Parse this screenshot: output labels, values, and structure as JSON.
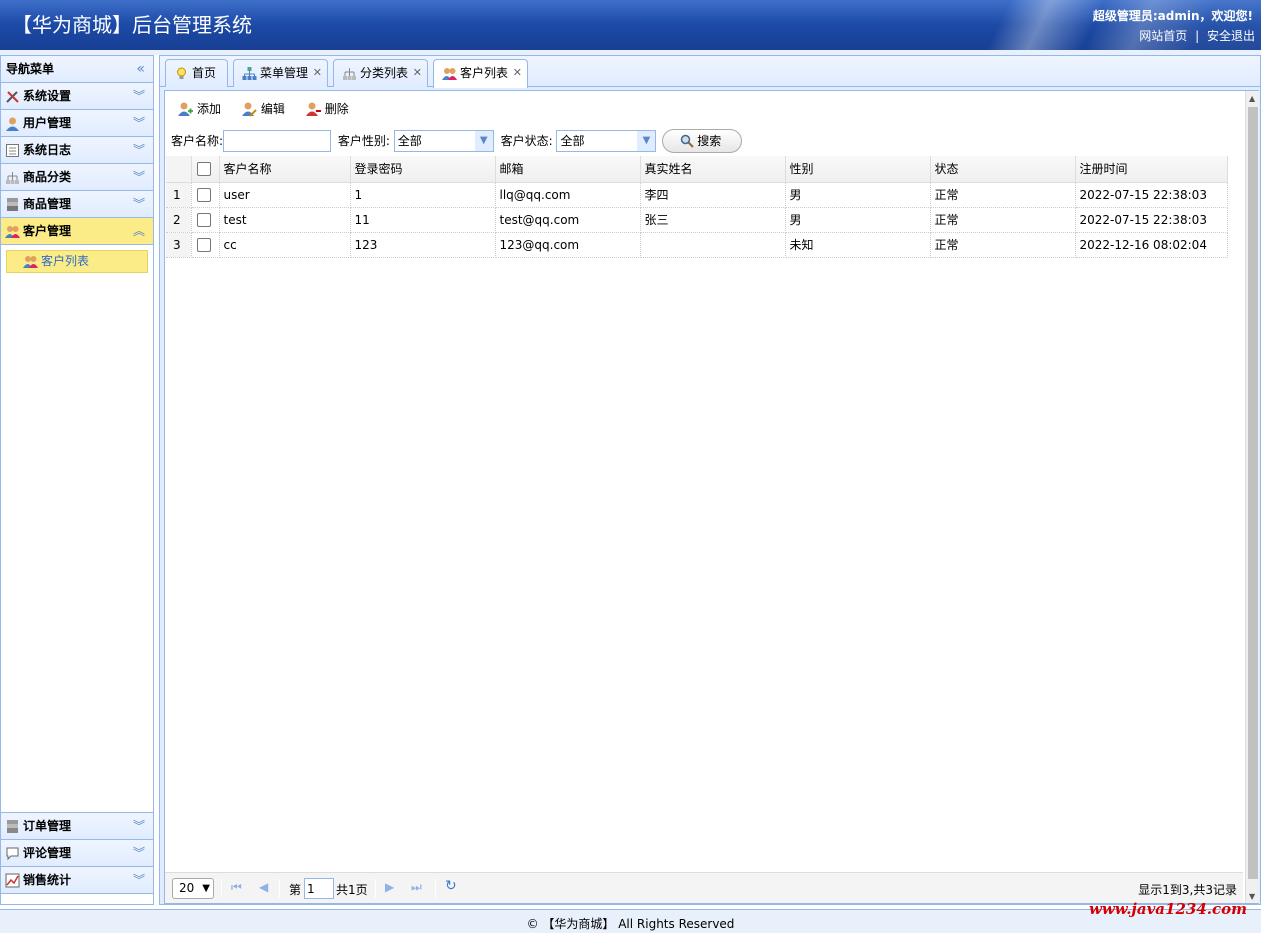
{
  "header": {
    "title": "【华为商城】后台管理系统",
    "welcome": "超级管理员:admin，欢迎您!",
    "link_home": "网站首页",
    "link_sep": "|",
    "link_logout": "安全退出"
  },
  "sidebar": {
    "title": "导航菜单",
    "collapse_icon": "«",
    "groups_top": [
      {
        "label": "系统设置",
        "icon": "tools-icon"
      },
      {
        "label": "用户管理",
        "icon": "user-icon"
      },
      {
        "label": "系统日志",
        "icon": "log-icon"
      },
      {
        "label": "商品分类",
        "icon": "category-icon"
      },
      {
        "label": "商品管理",
        "icon": "goods-icon"
      },
      {
        "label": "客户管理",
        "icon": "customer-icon",
        "active": true
      }
    ],
    "sub_items": [
      {
        "label": "客户列表"
      }
    ],
    "groups_bottom": [
      {
        "label": "订单管理",
        "icon": "order-icon"
      },
      {
        "label": "评论管理",
        "icon": "comment-icon"
      },
      {
        "label": "销售统计",
        "icon": "stats-icon"
      }
    ]
  },
  "tabs": [
    {
      "label": "首页",
      "closable": false
    },
    {
      "label": "菜单管理",
      "closable": true
    },
    {
      "label": "分类列表",
      "closable": true
    },
    {
      "label": "客户列表",
      "closable": true,
      "selected": true
    }
  ],
  "toolbar": {
    "add": "添加",
    "edit": "编辑",
    "delete": "删除"
  },
  "search": {
    "name_label": "客户名称:",
    "name_value": "",
    "sex_label": "客户性别:",
    "sex_value": "全部",
    "status_label": "客户状态:",
    "status_value": "全部",
    "button": "搜索"
  },
  "grid": {
    "columns": [
      "客户名称",
      "登录密码",
      "邮箱",
      "真实姓名",
      "性别",
      "状态",
      "注册时间"
    ],
    "rows": [
      {
        "num": "1",
        "cells": [
          "user",
          "1",
          "llq@qq.com",
          "李四",
          "男",
          "正常",
          "2022-07-15 22:38:03"
        ]
      },
      {
        "num": "2",
        "cells": [
          "test",
          "11",
          "test@qq.com",
          "张三",
          "男",
          "正常",
          "2022-07-15 22:38:03"
        ]
      },
      {
        "num": "3",
        "cells": [
          "cc",
          "123",
          "123@qq.com",
          "",
          "未知",
          "正常",
          "2022-12-16 08:02:04"
        ]
      }
    ]
  },
  "pager": {
    "page_size": "20",
    "page_prefix": "第",
    "page_value": "1",
    "page_total": "共1页",
    "info": "显示1到3,共3记录"
  },
  "footer": {
    "text": "© 【华为商城】 All Rights Reserved"
  },
  "watermark": "www.java1234.com",
  "colors": {
    "header_blue": "#1c4aa6",
    "border": "#95b8e7",
    "active": "#fbec88",
    "panel": "#e0ecff"
  }
}
